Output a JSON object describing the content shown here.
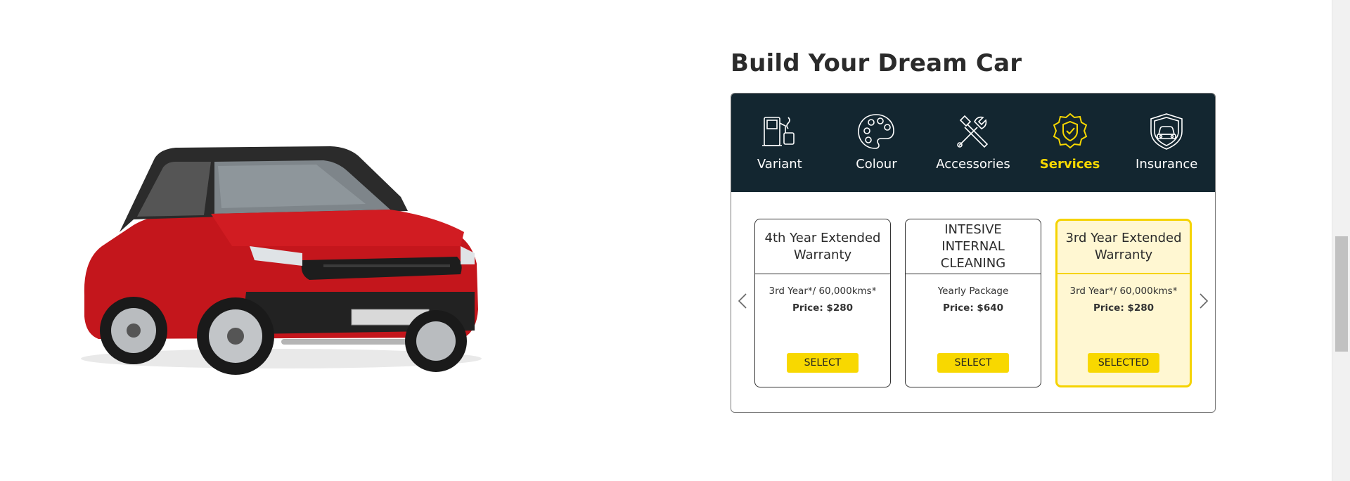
{
  "builder": {
    "title": "Build Your Dream Car"
  },
  "nav": [
    {
      "label": "Variant",
      "icon": "fuel-pump-icon",
      "active": false
    },
    {
      "label": "Colour",
      "icon": "palette-icon",
      "active": false
    },
    {
      "label": "Accessories",
      "icon": "tools-icon",
      "active": false
    },
    {
      "label": "Services",
      "icon": "badge-check-icon",
      "active": true
    },
    {
      "label": "Insurance",
      "icon": "shield-car-icon",
      "active": false
    }
  ],
  "cards": [
    {
      "title": "4th Year Extended Warranty",
      "subtitle": "3rd Year*/ 60,000kms*",
      "price": "Price: $280",
      "button": "SELECT",
      "selected": false
    },
    {
      "title": "INTESIVE INTERNAL CLEANING",
      "subtitle": "Yearly Package",
      "price": "Price: $640",
      "button": "SELECT",
      "selected": false
    },
    {
      "title": "3rd Year Extended Warranty",
      "subtitle": "3rd Year*/ 60,000kms*",
      "price": "Price: $280",
      "button": "SELECTED",
      "selected": true
    }
  ],
  "colors": {
    "nav_bg": "#132630",
    "accent": "#f8d800",
    "selected_bg": "#fff7d2"
  }
}
